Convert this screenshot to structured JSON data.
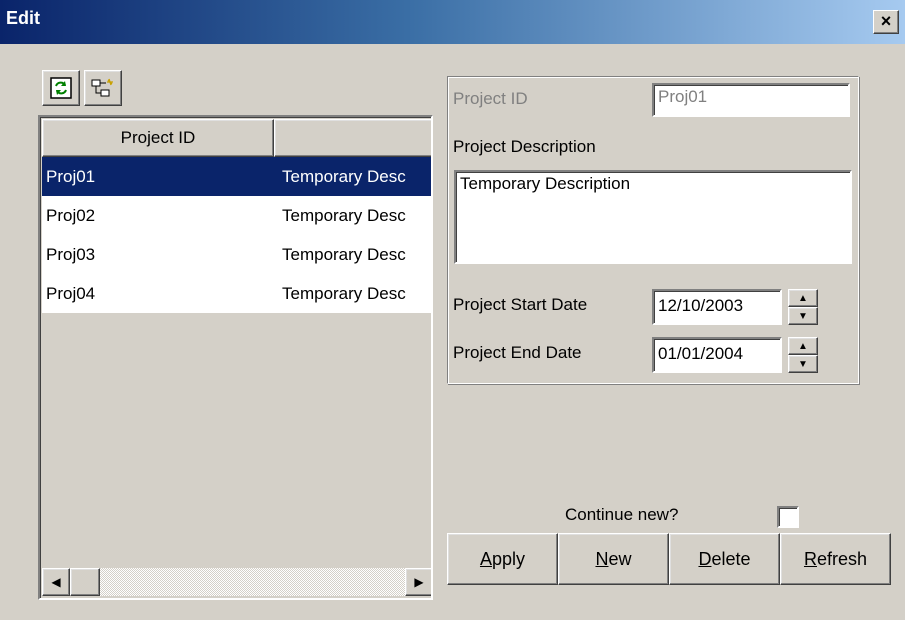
{
  "window": {
    "title": "Edit",
    "close_label": "×"
  },
  "toolbar": {
    "refresh_icon": "refresh-icon",
    "tree_icon": "tree-icon"
  },
  "list": {
    "columns": [
      "Project ID",
      ""
    ],
    "rows": [
      {
        "id": "Proj01",
        "desc": "Temporary Desc",
        "selected": true
      },
      {
        "id": "Proj02",
        "desc": "Temporary Desc",
        "selected": false
      },
      {
        "id": "Proj03",
        "desc": "Temporary Desc",
        "selected": false
      },
      {
        "id": "Proj04",
        "desc": "Temporary Desc",
        "selected": false
      }
    ],
    "scroll_left": "◀",
    "scroll_right": "▶"
  },
  "form": {
    "project_id_label": "Project ID",
    "project_id_value": "Proj01",
    "description_label": "Project Description",
    "description_value": "Temporary Description",
    "start_date_label": "Project Start Date",
    "start_date_value": "12/10/2003",
    "end_date_label": "Project End Date",
    "end_date_value": "01/01/2004",
    "spin_up": "▲",
    "spin_down": "▼"
  },
  "continue_new": {
    "label": "Continue new?",
    "checked": false
  },
  "buttons": {
    "apply": {
      "mnemonic": "A",
      "rest": "pply"
    },
    "new": {
      "mnemonic": "N",
      "rest": "ew"
    },
    "delete": {
      "mnemonic": "D",
      "rest": "elete"
    },
    "refresh": {
      "mnemonic": "R",
      "rest": "efresh"
    }
  },
  "colors": {
    "selection": "#0a246a",
    "face": "#d4d0c8"
  }
}
